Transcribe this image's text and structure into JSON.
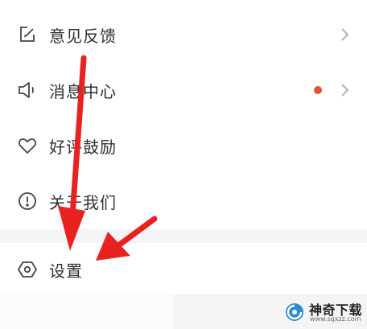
{
  "menu": {
    "items": [
      {
        "label": "意见反馈",
        "icon": "edit-note-icon",
        "has_chevron": true,
        "has_dot": false
      },
      {
        "label": "消息中心",
        "icon": "speaker-icon",
        "has_chevron": true,
        "has_dot": true
      },
      {
        "label": "好评鼓励",
        "icon": "heart-icon",
        "has_chevron": false,
        "has_dot": false
      },
      {
        "label": "关于我们",
        "icon": "info-circle-icon",
        "has_chevron": false,
        "has_dot": false
      }
    ]
  },
  "settings": {
    "label": "设置",
    "icon": "hexagon-settings-icon"
  },
  "annotation": {
    "arrow_color": "#e8231f",
    "arrows": 2
  },
  "watermark": {
    "text": "神奇下载",
    "url": "www.sqxzz.com"
  },
  "colors": {
    "accent_dot": "#e2542a",
    "text": "#2f2f2f",
    "icon": "#444444",
    "chevron": "#b5b5b5"
  }
}
